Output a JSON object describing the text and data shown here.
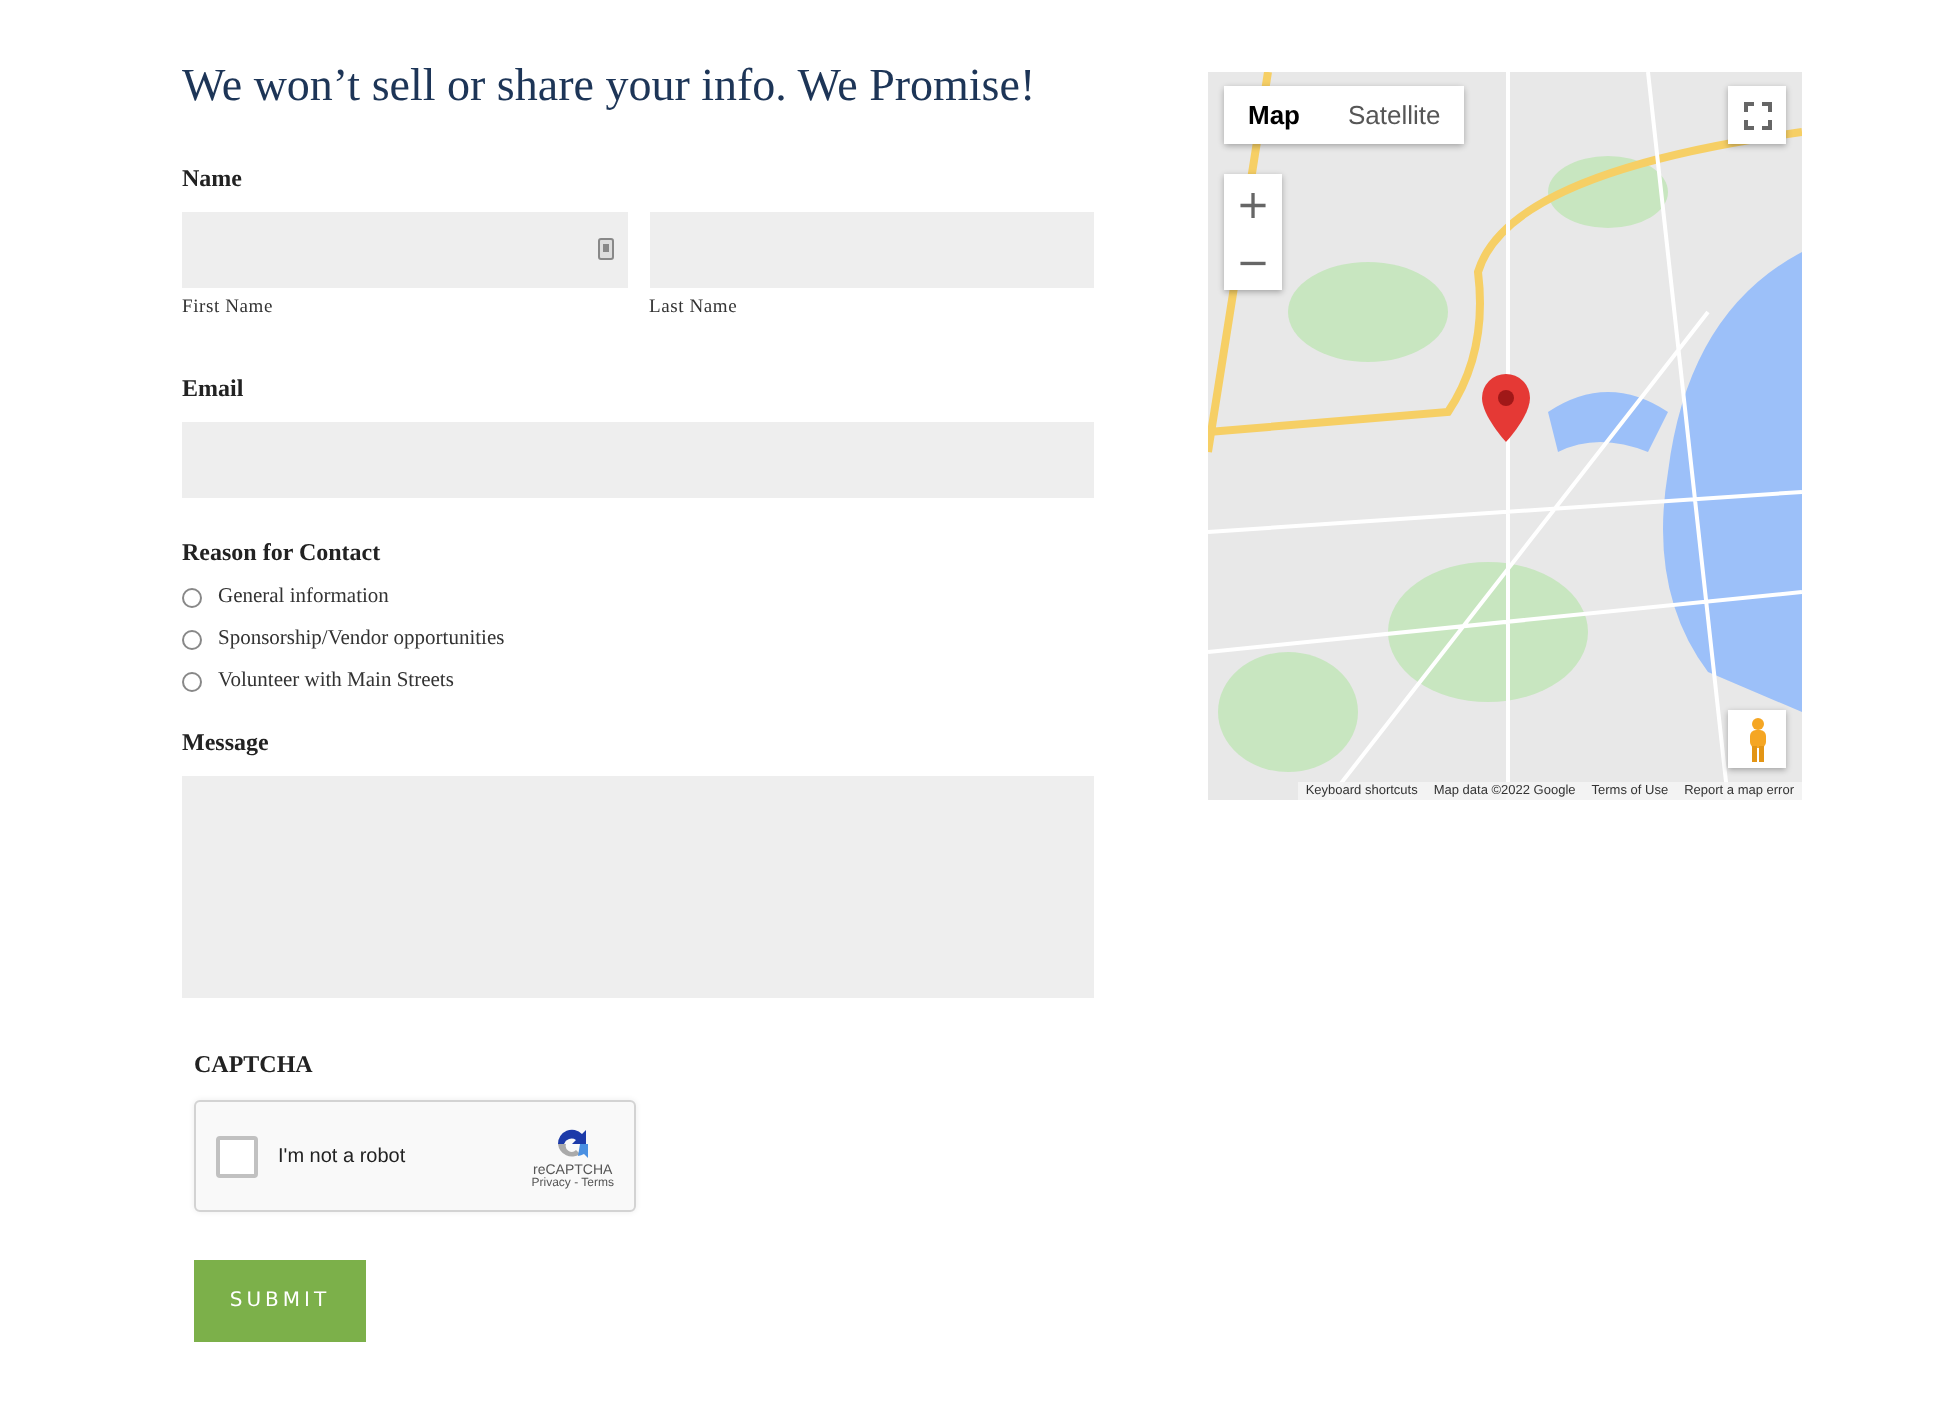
{
  "heading": "We won’t sell or share your info. We Promise!",
  "name_section": {
    "label": "Name",
    "fields": [
      {
        "sublabel": "First Name",
        "autofill_icon": true
      },
      {
        "sublabel": "Last Name",
        "autofill_icon": false
      }
    ]
  },
  "email": {
    "label": "Email"
  },
  "reason": {
    "label": "Reason for Contact",
    "options": [
      {
        "label": "General information",
        "selected": false
      },
      {
        "label": "Sponsorship/Vendor opportunities",
        "selected": false
      },
      {
        "label": "Volunteer with Main Streets",
        "selected": false
      }
    ]
  },
  "message": {
    "label": "Message"
  },
  "captcha": {
    "label": "CAPTCHA",
    "checkbox_label": "I'm not a robot",
    "checked": false,
    "brand": "reCAPTCHA",
    "links": "Privacy - Terms"
  },
  "submit": "SUBMIT",
  "map": {
    "map_types": [
      {
        "label": "Map",
        "selected": true
      },
      {
        "label": "Satellite",
        "selected": false
      }
    ],
    "zoom_in": "+",
    "zoom_out": "−",
    "footer": [
      "Keyboard shortcuts",
      "Map data ©2022 Google",
      "Terms of Use",
      "Report a map error"
    ]
  }
}
